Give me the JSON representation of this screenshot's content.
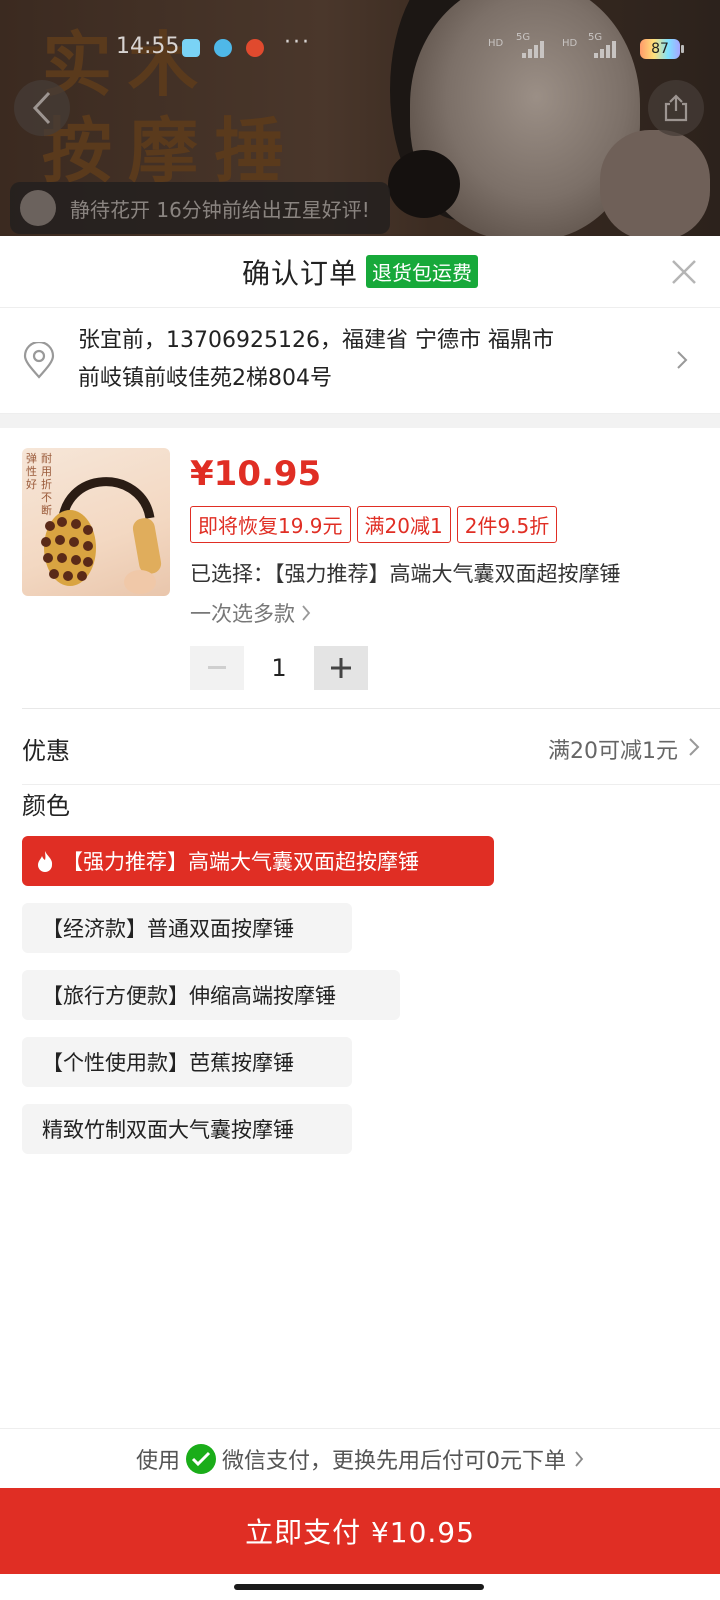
{
  "status_bar": {
    "time": "14:55",
    "battery": "87",
    "net1": "5G",
    "net2": "5G",
    "hd": "HD"
  },
  "banner": {
    "bg_title_line1": "实木",
    "bg_title_line2": "按摩捶"
  },
  "review": {
    "text": "静待花开 16分钟前给出五星好评!"
  },
  "header": {
    "title": "确认订单",
    "badge": "退货包运费"
  },
  "address": {
    "line1": "张宜前，13706925126，福建省 宁德市 福鼎市",
    "line2": "前岐镇前岐佳苑2梯804号"
  },
  "product": {
    "image_text_right": "耐用折不断",
    "image_text_left": "弹性好",
    "price": "¥10.95",
    "tags": [
      "即将恢复19.9元",
      "满20减1",
      "2件9.5折"
    ],
    "selected_label": "已选择：",
    "selected_value": "【强力推荐】高端大气囊双面超按摩锤",
    "multi_select": "一次选多款",
    "quantity": "1"
  },
  "promo": {
    "label": "优惠",
    "value": "满20可减1元"
  },
  "color": {
    "title": "颜色",
    "options": [
      "【强力推荐】高端大气囊双面超按摩锤",
      "【经济款】普通双面按摩锤",
      "【旅行方便款】伸缩高端按摩锤",
      "【个性使用款】芭蕉按摩锤",
      "精致竹制双面大气囊按摩锤"
    ]
  },
  "footer": {
    "pay_prefix": "使用",
    "pay_method": "微信支付，更换先用后付可0元下单",
    "pay_button": "立即支付 ¥10.95"
  },
  "colors": {
    "accent_red": "#e02e24",
    "badge_green": "#17a93a",
    "wechat_green": "#1aad19"
  }
}
